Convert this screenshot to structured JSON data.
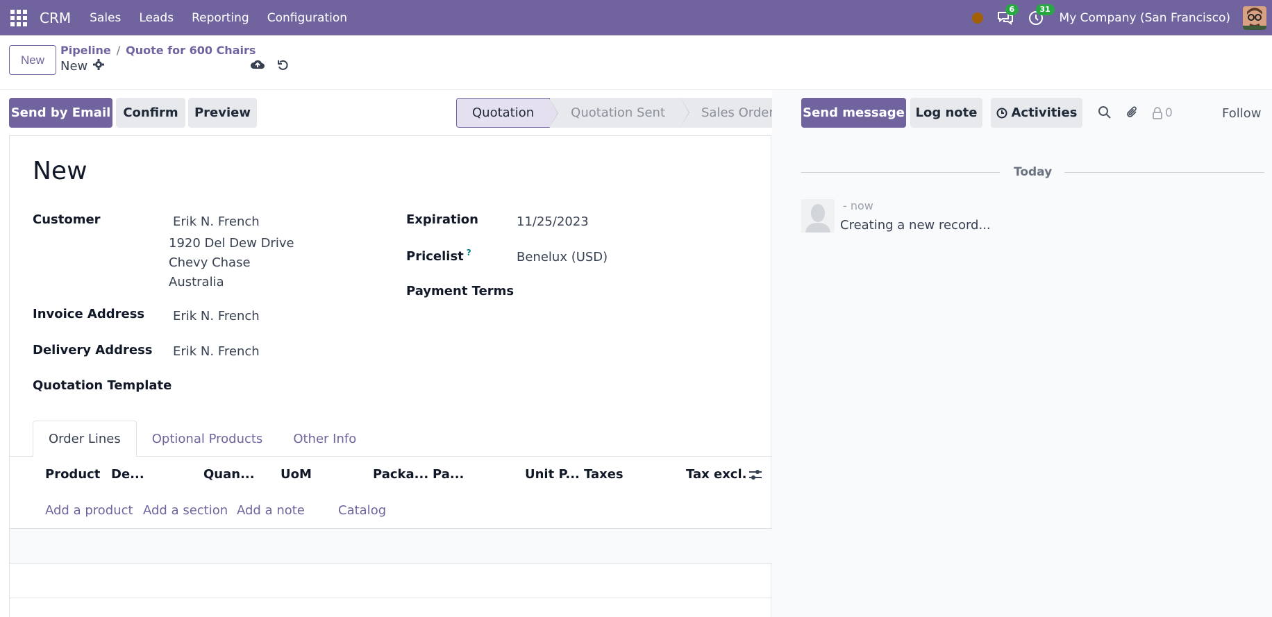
{
  "navbar": {
    "app_name": "CRM",
    "menu": [
      "Sales",
      "Leads",
      "Reporting",
      "Configuration"
    ],
    "messages_badge": "6",
    "activities_badge": "31",
    "company": "My Company (San Francisco)"
  },
  "control": {
    "new_label": "New",
    "breadcrumb_parent": "Pipeline",
    "breadcrumb_sep": "/",
    "breadcrumb_current": "Quote for 600 Chairs",
    "record_name": "New"
  },
  "actions": {
    "send_email": "Send by Email",
    "confirm": "Confirm",
    "preview": "Preview"
  },
  "statusbar": {
    "stages": [
      "Quotation",
      "Quotation Sent",
      "Sales Order"
    ],
    "active": "Quotation"
  },
  "form": {
    "title": "New",
    "customer_label": "Customer",
    "customer_name": "Erik N. French",
    "customer_address": [
      "1920 Del Dew Drive",
      "Chevy Chase",
      "Australia"
    ],
    "invoice_label": "Invoice Address",
    "invoice_value": "Erik N. French",
    "delivery_label": "Delivery Address",
    "delivery_value": "Erik N. French",
    "template_label": "Quotation Template",
    "expiration_label": "Expiration",
    "expiration_value": "11/25/2023",
    "pricelist_label": "Pricelist",
    "pricelist_help": "?",
    "pricelist_value": "Benelux (USD)",
    "payment_terms_label": "Payment Terms"
  },
  "tabs": [
    "Order Lines",
    "Optional Products",
    "Other Info"
  ],
  "order_lines": {
    "columns": [
      "Product",
      "De...",
      "Quan...",
      "UoM",
      "Packa...",
      "Pa...",
      "Unit P...",
      "Taxes",
      "Tax excl."
    ],
    "add_links": [
      "Add a product",
      "Add a section",
      "Add a note",
      "Catalog"
    ]
  },
  "chatter": {
    "send_message": "Send message",
    "log_note": "Log note",
    "activities": "Activities",
    "followers_count": "0",
    "follow": "Follow",
    "today": "Today",
    "message_time": "- now",
    "message_body": "Creating a new record..."
  },
  "colors": {
    "brand": "#71639e",
    "badge": "#28a745",
    "status_dot": "#a35f08"
  }
}
